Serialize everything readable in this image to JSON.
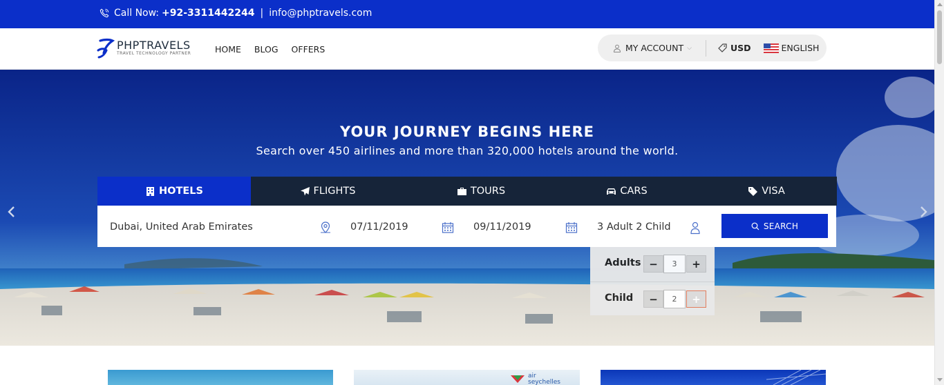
{
  "topbar": {
    "call_label": "Call Now:",
    "phone": "+92-3311442244",
    "separator": "|",
    "email": "info@phptravels.com",
    "icon": "phone-icon"
  },
  "header": {
    "brand": "PHPTRAVELS",
    "tagline": "TRAVEL TECHNOLOGY PARTNER",
    "nav": [
      "HOME",
      "BLOG",
      "OFFERS"
    ],
    "account_label": "MY ACCOUNT",
    "currency": "USD",
    "language": "ENGLISH"
  },
  "hero": {
    "title": "YOUR JOURNEY BEGINS HERE",
    "subtitle": "Search over 450 airlines and more than 320,000 hotels around the world."
  },
  "tabs": [
    {
      "label": "HOTELS",
      "icon": "hotel-icon",
      "active": true
    },
    {
      "label": "FLIGHTS",
      "icon": "plane-icon",
      "active": false
    },
    {
      "label": "TOURS",
      "icon": "suitcase-icon",
      "active": false
    },
    {
      "label": "CARS",
      "icon": "car-icon",
      "active": false
    },
    {
      "label": "VISA",
      "icon": "tag-icon",
      "active": false
    }
  ],
  "search": {
    "destination": "Dubai, United Arab Emirates",
    "checkin": "07/11/2019",
    "checkout": "09/11/2019",
    "guests": "3 Adult 2 Child",
    "button_label": "SEARCH"
  },
  "guests_dropdown": {
    "adults_label": "Adults",
    "adults_value": "3",
    "child_label": "Child",
    "child_value": "2",
    "minus": "−",
    "plus": "+"
  },
  "cards": {
    "card2_logo_line1": "air",
    "card2_logo_line2": "seychelles"
  },
  "colors": {
    "brand_blue": "#0b2fc9",
    "tab_bar": "#162439",
    "account_bg": "#efefef"
  }
}
